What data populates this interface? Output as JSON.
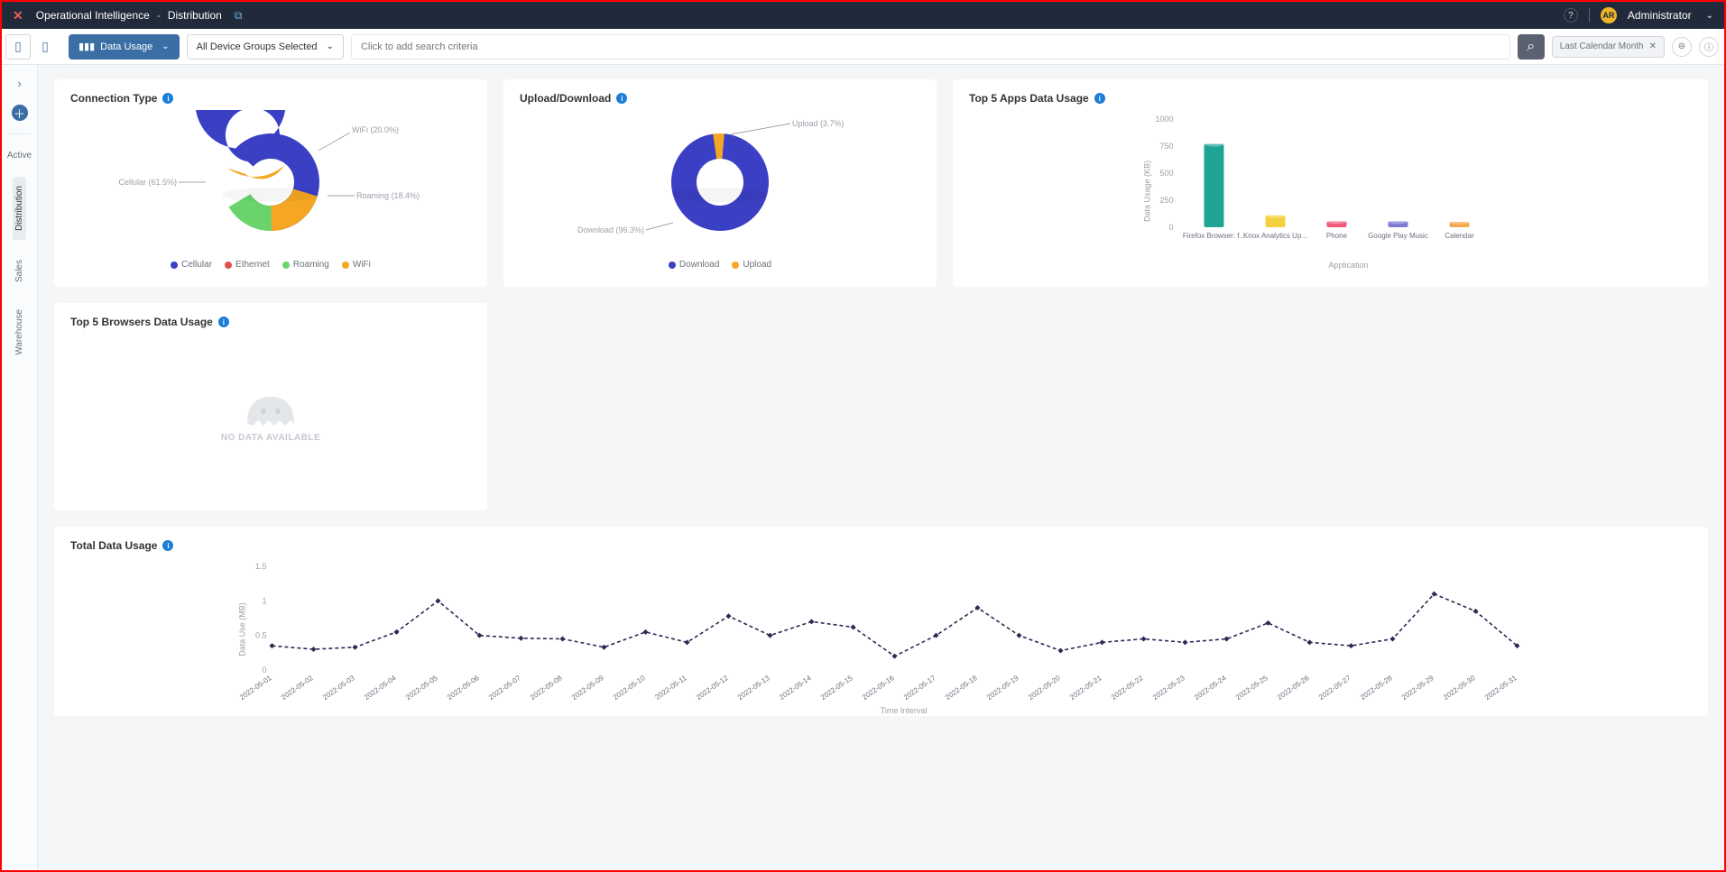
{
  "header": {
    "app": "Operational Intelligence",
    "page": "Distribution",
    "user": "Administrator",
    "avatar": "AR"
  },
  "toolbar": {
    "report_btn": "Data Usage",
    "group_btn": "All Device Groups Selected",
    "search_ph": "Click to add search criteria",
    "time_pill": "Last Calendar Month"
  },
  "sidebar": {
    "header": "Active",
    "items": [
      "Distribution",
      "Sales",
      "Warehouse"
    ],
    "active": 0
  },
  "cards": {
    "connection": {
      "title": "Connection Type",
      "legend": [
        "Cellular",
        "Ethernet",
        "Roaming",
        "WiFi"
      ],
      "labels": {
        "cellular": "Cellular (61.5%)",
        "wifi": "WiFi (20.0%)",
        "roaming": "Roaming (18.4%)"
      }
    },
    "updown": {
      "title": "Upload/Download",
      "legend": [
        "Download",
        "Upload"
      ],
      "labels": {
        "download": "Download (96.3%)",
        "upload": "Upload (3.7%)"
      }
    },
    "topapps": {
      "title": "Top 5 Apps Data Usage",
      "ylabel": "Data Usage (KB)",
      "xlabel": "Application"
    },
    "topbrowsers": {
      "title": "Top 5 Browsers Data Usage",
      "nodata": "NO DATA AVAILABLE"
    },
    "total": {
      "title": "Total Data Usage",
      "ylabel": "Data Use (MB)",
      "xlabel": "Time Interval"
    }
  },
  "chart_data": [
    {
      "id": "connection_type",
      "type": "pie",
      "title": "Connection Type",
      "series": [
        {
          "name": "Cellular",
          "value": 61.5,
          "color": "#3b3fc4"
        },
        {
          "name": "WiFi",
          "value": 20.0,
          "color": "#f5a623"
        },
        {
          "name": "Roaming",
          "value": 18.4,
          "color": "#6bd36b"
        },
        {
          "name": "Ethernet",
          "value": 0.0,
          "color": "#e0524c"
        }
      ]
    },
    {
      "id": "upload_download",
      "type": "pie",
      "title": "Upload/Download",
      "series": [
        {
          "name": "Download",
          "value": 96.3,
          "color": "#3b3fc4"
        },
        {
          "name": "Upload",
          "value": 3.7,
          "color": "#f5a623"
        }
      ]
    },
    {
      "id": "top5_apps",
      "type": "bar",
      "title": "Top 5 Apps Data Usage",
      "xlabel": "Application",
      "ylabel": "Data Usage (KB)",
      "ylim": [
        0,
        1000
      ],
      "yticks": [
        0,
        250,
        500,
        750,
        1000
      ],
      "categories": [
        "Firefox Browser: f...",
        "Knox Analytics Up...",
        "Phone",
        "Google Play Music",
        "Calendar"
      ],
      "values": [
        770,
        110,
        55,
        55,
        50
      ],
      "colors": [
        "#1fa595",
        "#f4cf3e",
        "#ef597b",
        "#7e7bd6",
        "#f5a74a"
      ]
    },
    {
      "id": "top5_browsers",
      "type": "bar",
      "title": "Top 5 Browsers Data Usage",
      "categories": [],
      "values": [],
      "nodata": true
    },
    {
      "id": "total_data_usage",
      "type": "line",
      "title": "Total Data Usage",
      "xlabel": "Time Interval",
      "ylabel": "Data Use (MB)",
      "ylim": [
        0,
        1.5
      ],
      "yticks": [
        0,
        0.5,
        1,
        1.5
      ],
      "x": [
        "2022-05-01",
        "2022-05-02",
        "2022-05-03",
        "2022-05-04",
        "2022-05-05",
        "2022-05-06",
        "2022-05-07",
        "2022-05-08",
        "2022-05-09",
        "2022-05-10",
        "2022-05-11",
        "2022-05-12",
        "2022-05-13",
        "2022-05-14",
        "2022-05-15",
        "2022-05-16",
        "2022-05-17",
        "2022-05-18",
        "2022-05-19",
        "2022-05-20",
        "2022-05-21",
        "2022-05-22",
        "2022-05-23",
        "2022-05-24",
        "2022-05-25",
        "2022-05-26",
        "2022-05-27",
        "2022-05-28",
        "2022-05-29",
        "2022-05-30",
        "2022-05-31"
      ],
      "y": [
        0.35,
        0.3,
        0.33,
        0.55,
        1.0,
        0.5,
        0.46,
        0.45,
        0.33,
        0.55,
        0.4,
        0.78,
        0.5,
        0.7,
        0.62,
        0.2,
        0.5,
        0.9,
        0.5,
        0.28,
        0.4,
        0.45,
        0.4,
        0.45,
        0.68,
        0.4,
        0.35,
        0.45,
        1.1,
        0.85,
        0.35
      ]
    }
  ]
}
